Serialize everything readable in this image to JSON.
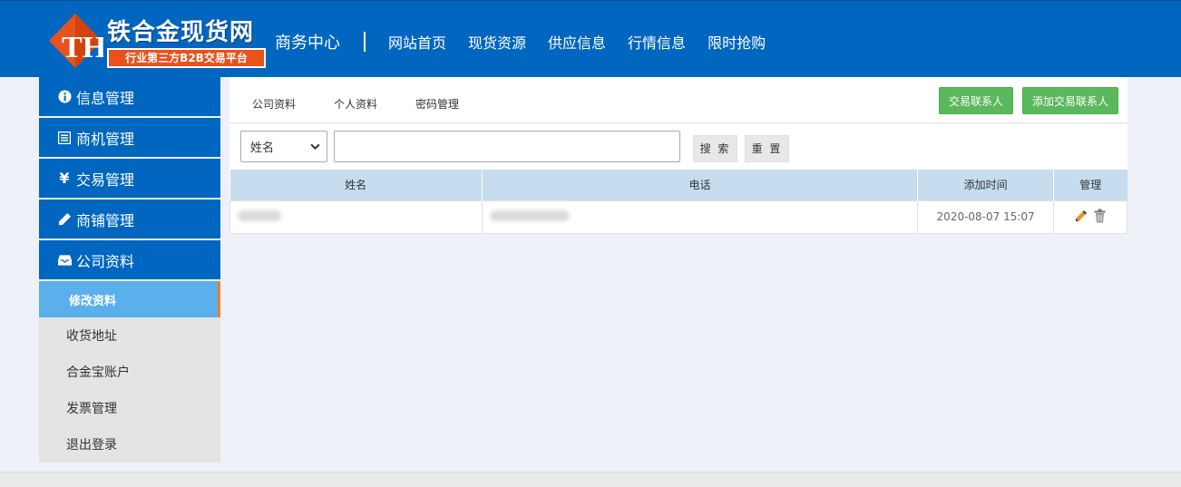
{
  "header": {
    "logo_title": "铁合金现货网",
    "logo_subtitle": "行业第三方B2B交易平台",
    "center_title": "商务中心",
    "nav": [
      "网站首页",
      "现货资源",
      "供应信息",
      "行情信息",
      "限时抢购"
    ]
  },
  "sidebar": {
    "sections": [
      {
        "label": "信息管理",
        "icon": "info-icon"
      },
      {
        "label": "商机管理",
        "icon": "list-icon"
      },
      {
        "label": "交易管理",
        "icon": "yen-icon"
      },
      {
        "label": "商铺管理",
        "icon": "pencil-icon"
      },
      {
        "label": "公司资料",
        "icon": "inbox-icon"
      }
    ],
    "sub_items": [
      "修改资料",
      "收货地址",
      "合金宝账户",
      "发票管理",
      "退出登录"
    ]
  },
  "tabs": [
    "公司资料",
    "个人资料",
    "密码管理"
  ],
  "buttons": {
    "contacts": "交易联系人",
    "add_contact": "添加交易联系人",
    "search": "搜 索",
    "reset": "重 置"
  },
  "filter": {
    "select_value": "姓名",
    "input_value": ""
  },
  "table": {
    "headers": [
      "姓名",
      "电话",
      "添加时间",
      "管理"
    ],
    "rows": [
      {
        "time": "2020-08-07 15:07"
      }
    ]
  },
  "colors": {
    "brand_blue": "#0066bf",
    "accent_green": "#5cb85c",
    "active_sub": "#5ab0ea",
    "accent_orange": "#f08026"
  }
}
